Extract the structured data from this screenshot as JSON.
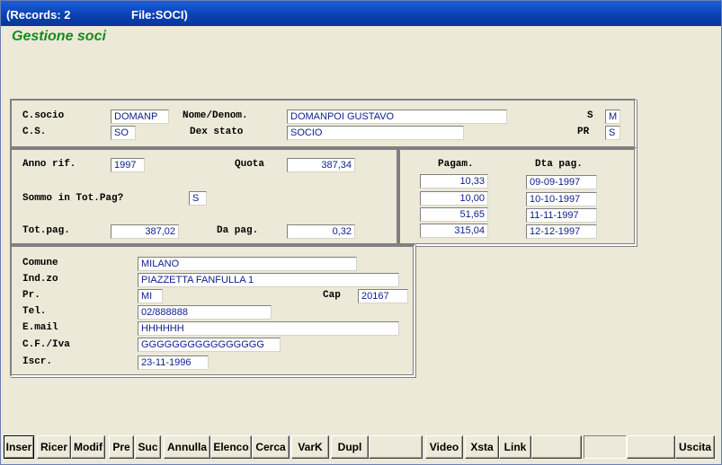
{
  "titlebar": {
    "records": "(Records: 2",
    "file": "File:SOCI)"
  },
  "heading": "Gestione soci",
  "header_panel": {
    "csocio_label": "C.socio",
    "csocio_value": "DOMANP",
    "nome_label": "Nome/Denom.",
    "nome_value": "DOMANPOI GUSTAVO",
    "s_label": "S",
    "s_value": "M",
    "cs_label": "C.S.",
    "cs_value": "SO",
    "dex_label": "Dex stato",
    "dex_value": "SOCIO",
    "pr_label": "PR",
    "pr_value": "S"
  },
  "quota_panel": {
    "anno_label": "Anno rif.",
    "anno_value": "1997",
    "quota_label": "Quota",
    "quota_value": "387,34",
    "sommo_label": "Sommo in Tot.Pag?",
    "sommo_value": "S",
    "totpag_label": "Tot.pag.",
    "totpag_value": "387,02",
    "dapag_label": "Da pag.",
    "dapag_value": "0,32"
  },
  "payments": {
    "col_amount": "Pagam.",
    "col_date": "Dta pag.",
    "rows": [
      {
        "amount": "10,33",
        "date": "09-09-1997"
      },
      {
        "amount": "10,00",
        "date": "10-10-1997"
      },
      {
        "amount": "51,65",
        "date": "11-11-1997"
      },
      {
        "amount": "315,04",
        "date": "12-12-1997"
      }
    ]
  },
  "address_panel": {
    "comune_label": "Comune",
    "comune_value": "MILANO",
    "indzo_label": "Ind.zo",
    "indzo_value": "PIAZZETTA FANFULLA 1",
    "pr_label": "Pr.",
    "pr_value": "MI",
    "cap_label": "Cap",
    "cap_value": "20167",
    "tel_label": "Tel.",
    "tel_value": "02/888888",
    "email_label": "E.mail",
    "email_value": "HHHHHH",
    "cf_label": "C.F./Iva",
    "cf_value": "GGGGGGGGGGGGGGGG",
    "iscr_label": "Iscr.",
    "iscr_value": "23-11-1996"
  },
  "buttons": {
    "inser": "Inser",
    "ricer": "Ricer",
    "modif": "Modif",
    "pre": "Pre",
    "suc": "Suc",
    "annulla": "Annulla",
    "elenco": "Elenco",
    "cerca": "Cerca",
    "vark": "VarK",
    "dupl": "Dupl",
    "video": "Video",
    "xsta": "Xsta",
    "link": "Link",
    "uscita": "Uscita"
  }
}
